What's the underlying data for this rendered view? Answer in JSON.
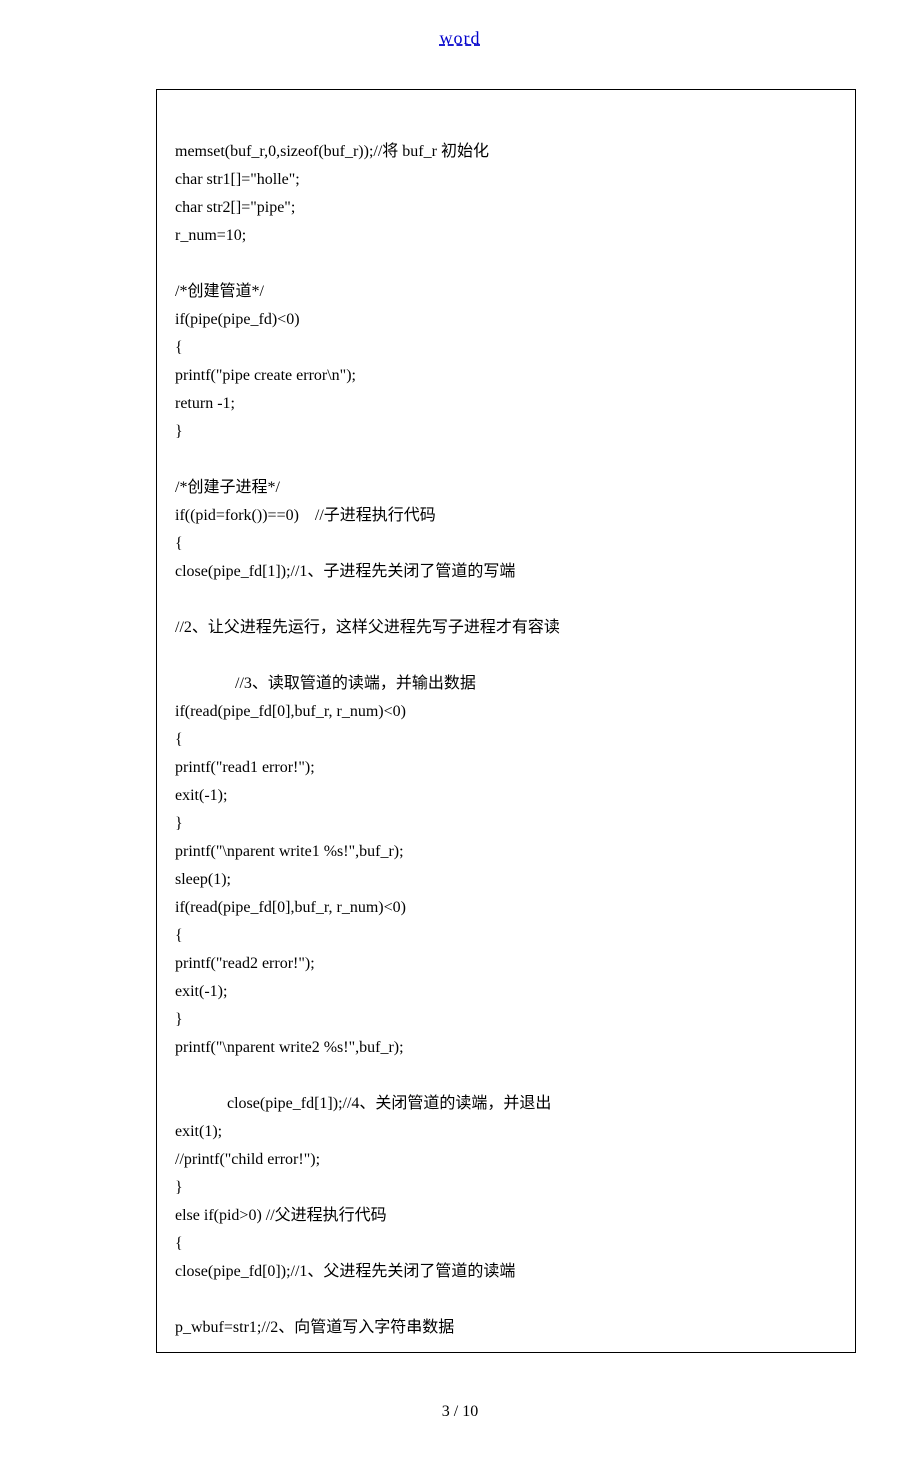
{
  "header": {
    "link_text": "word"
  },
  "code": {
    "lines": [
      "",
      "memset(buf_r,0,sizeof(buf_r));//将 buf_r 初始化",
      "char str1[]=\"holle\";",
      "char str2[]=\"pipe\";",
      "r_num=10;",
      "",
      "/*创建管道*/",
      "if(pipe(pipe_fd)<0)",
      "{",
      "printf(\"pipe create error\\n\");",
      "return -1;",
      "}",
      "",
      "/*创建子进程*/",
      "if((pid=fork())==0)    //子进程执行代码",
      "{",
      "close(pipe_fd[1]);//1、子进程先关闭了管道的写端",
      "",
      "//2、让父进程先运行，这样父进程先写子进程才有容读",
      "",
      "               //3、读取管道的读端，并输出数据",
      "if(read(pipe_fd[0],buf_r, r_num)<0)",
      "{",
      "printf(\"read1 error!\");",
      "exit(-1);",
      "}",
      "printf(\"\\nparent write1 %s!\",buf_r);",
      "sleep(1);",
      "if(read(pipe_fd[0],buf_r, r_num)<0)",
      "{",
      "printf(\"read2 error!\");",
      "exit(-1);",
      "}",
      "printf(\"\\nparent write2 %s!\",buf_r);",
      "",
      "             close(pipe_fd[1]);//4、关闭管道的读端，并退出",
      "exit(1);",
      "//printf(\"child error!\");",
      "}",
      "else if(pid>0) //父进程执行代码",
      "{",
      "close(pipe_fd[0]);//1、父进程先关闭了管道的读端",
      "",
      "p_wbuf=str1;//2、向管道写入字符串数据"
    ]
  },
  "footer": {
    "page_indicator": "3  / 10"
  }
}
